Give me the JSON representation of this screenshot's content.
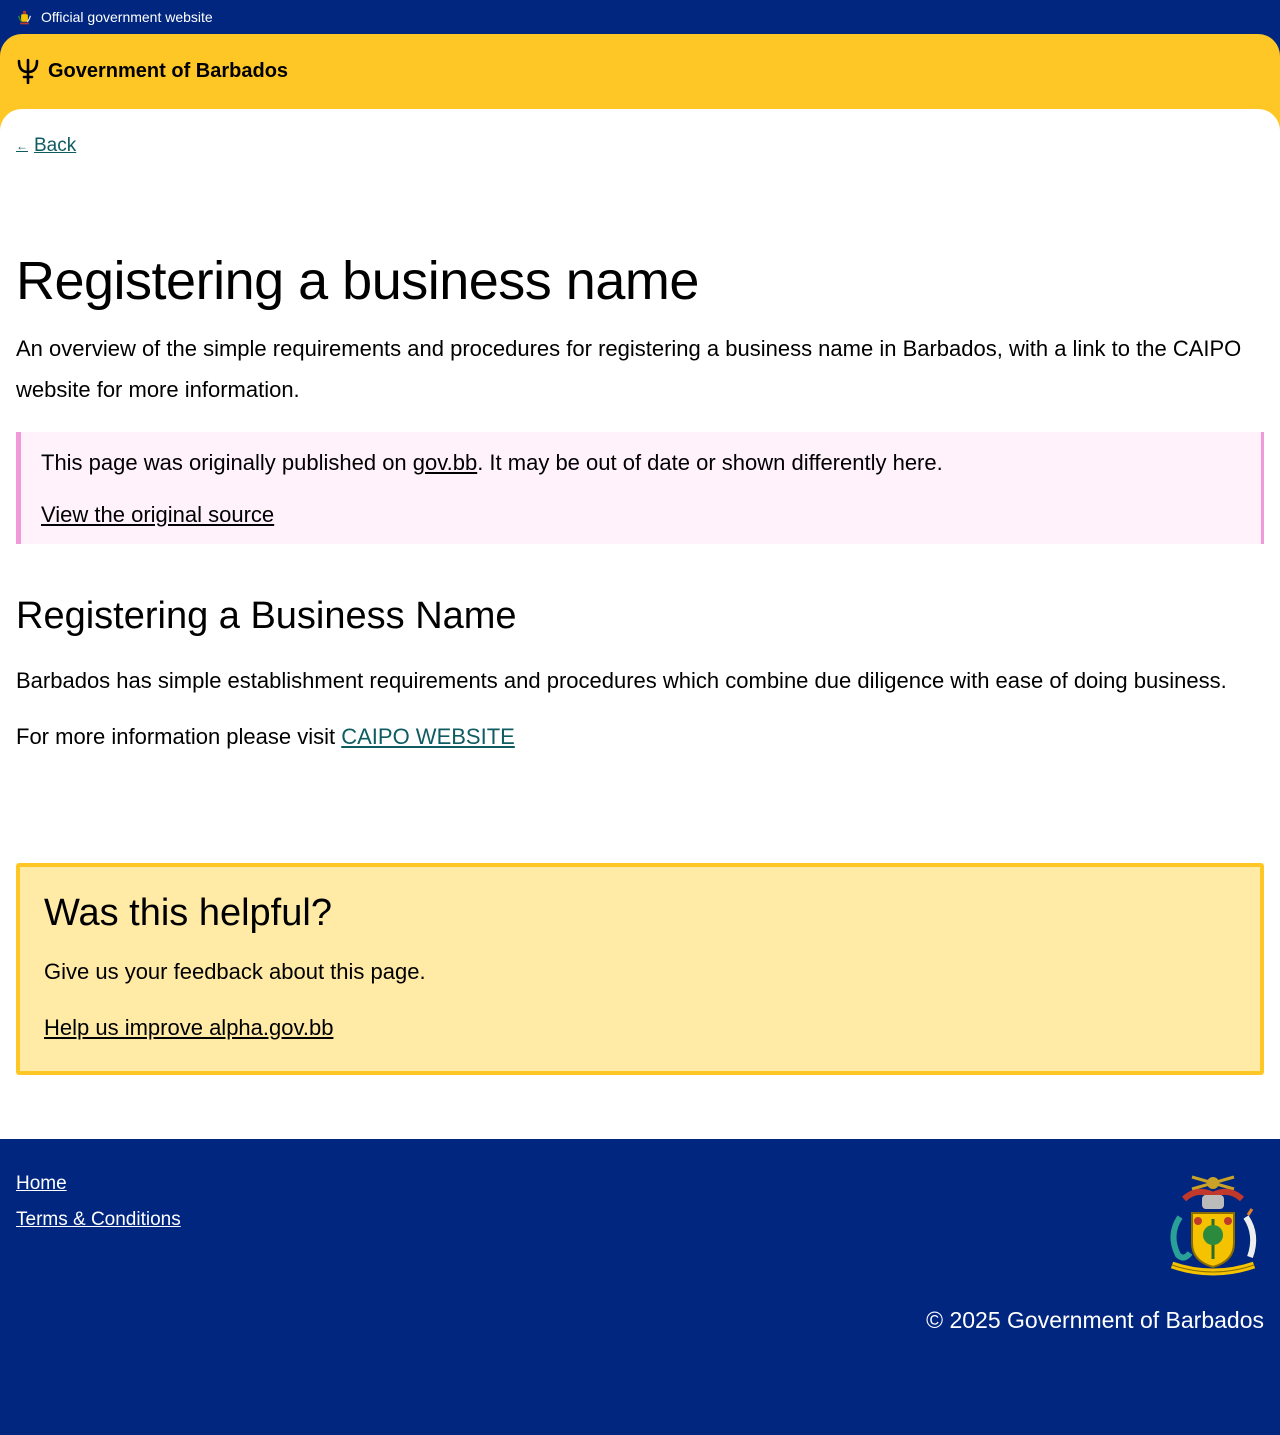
{
  "topbar": {
    "label": "Official government website"
  },
  "header": {
    "brand": "Government of Barbados"
  },
  "nav": {
    "back": "Back"
  },
  "page": {
    "title": "Registering a business name",
    "lead": "An overview of the simple requirements and procedures for registering a business name in Barbados, with a link to the CAIPO website for more information."
  },
  "notice": {
    "prefix": "This page was originally published on ",
    "link": "gov.bb",
    "suffix": ". It may be out of date or shown differently here.",
    "source_link": "View the original source"
  },
  "content": {
    "heading": "Registering a Business Name",
    "paragraph": "Barbados has simple establishment requirements and procedures which combine due diligence with ease of doing business.",
    "more_prefix": "For more information please visit ",
    "more_link": "CAIPO WEBSITE"
  },
  "feedback": {
    "title": "Was this helpful?",
    "text": "Give us your feedback about this page.",
    "link": "Help us improve alpha.gov.bb"
  },
  "footer": {
    "links": [
      "Home",
      "Terms & Conditions"
    ],
    "copyright": "© 2025 Government of Barbados"
  },
  "colors": {
    "navy": "#00267f",
    "yellow": "#ffc726",
    "teal_link": "#0e5c62",
    "notice_bg": "#fff2fa",
    "notice_border": "#f29ad7",
    "feedback_bg": "#ffeaa6"
  },
  "icons": {
    "topbar": "coat-of-arms-icon",
    "brand": "trident-icon",
    "back": "arrow-left-icon",
    "footer": "coat-of-arms-icon"
  }
}
